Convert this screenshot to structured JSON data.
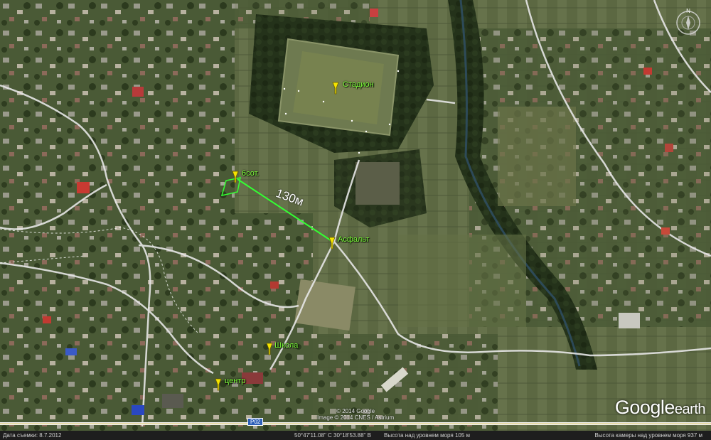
{
  "app": "Google earth",
  "logo": {
    "google": "Google",
    "earth": "earth"
  },
  "placemarks": [
    {
      "id": "stadium",
      "label": "Стадион"
    },
    {
      "id": "plot",
      "label": "6сот."
    },
    {
      "id": "asphalt",
      "label": "Асфальт"
    },
    {
      "id": "school",
      "label": "Школа"
    },
    {
      "id": "center",
      "label": "центр"
    }
  ],
  "measure": {
    "distance_label": "130м",
    "color": "#33ff33"
  },
  "road_badge": "P02",
  "copyright": {
    "line1": "© 2014 Google",
    "line2": "Image © 2014 CNES / Astrium"
  },
  "status": {
    "date": "Дата съемки: 8.7.2012",
    "coords": "50°47'11.08\" С 30°18'53.88\" В",
    "elevation": "Высота над уровнем моря   105 м",
    "eye_alt": "Высота камеры над уровнем моря   937 м"
  },
  "compass": {
    "north": "N"
  },
  "colors": {
    "pin": "#f4e400",
    "label": "#7dff3a",
    "path": "#33ff33",
    "road": "#f2f2f2"
  }
}
